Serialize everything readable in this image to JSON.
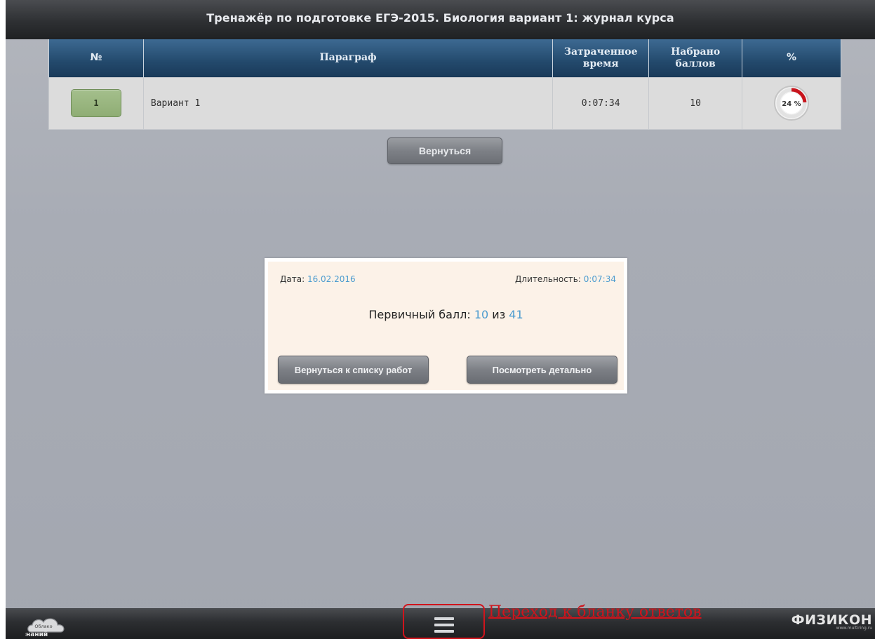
{
  "header": {
    "title": "Тренажёр по подготовке ЕГЭ-2015. Биология вариант 1: журнал курса"
  },
  "table": {
    "columns": {
      "no": "№",
      "paragraph": "Параграф",
      "time": "Затраченное время",
      "score": "Набрано баллов",
      "percent": "%"
    },
    "rows": [
      {
        "no": "1",
        "paragraph": "Вариант 1",
        "time": "0:07:34",
        "score": "10",
        "percent_label": "24 %",
        "percent_value": 24
      }
    ]
  },
  "back_button": {
    "label": "Вернуться"
  },
  "result": {
    "date_label": "Дата:",
    "date_value": "16.02.2016",
    "duration_label": "Длительность:",
    "duration_value": "0:07:34",
    "score_label": "Первичный балл:",
    "score_value": "10",
    "score_of": "из",
    "score_max": "41",
    "return_button": "Вернуться к списку работ",
    "details_button": "Посмотреть детально"
  },
  "bottom": {
    "left_logo_top": "Облако",
    "left_logo_bottom": "знаний",
    "hint": "Переход к бланку ответов",
    "right_logo": "ФИЗИКОН",
    "right_logo_url": "www.multiring.ru"
  },
  "colors": {
    "header_blue": "#23496c",
    "accent_blue": "#4b9bcf",
    "annotation_red": "#d0141c",
    "progress_red": "#c8141c",
    "number_green": "#8fad74"
  }
}
